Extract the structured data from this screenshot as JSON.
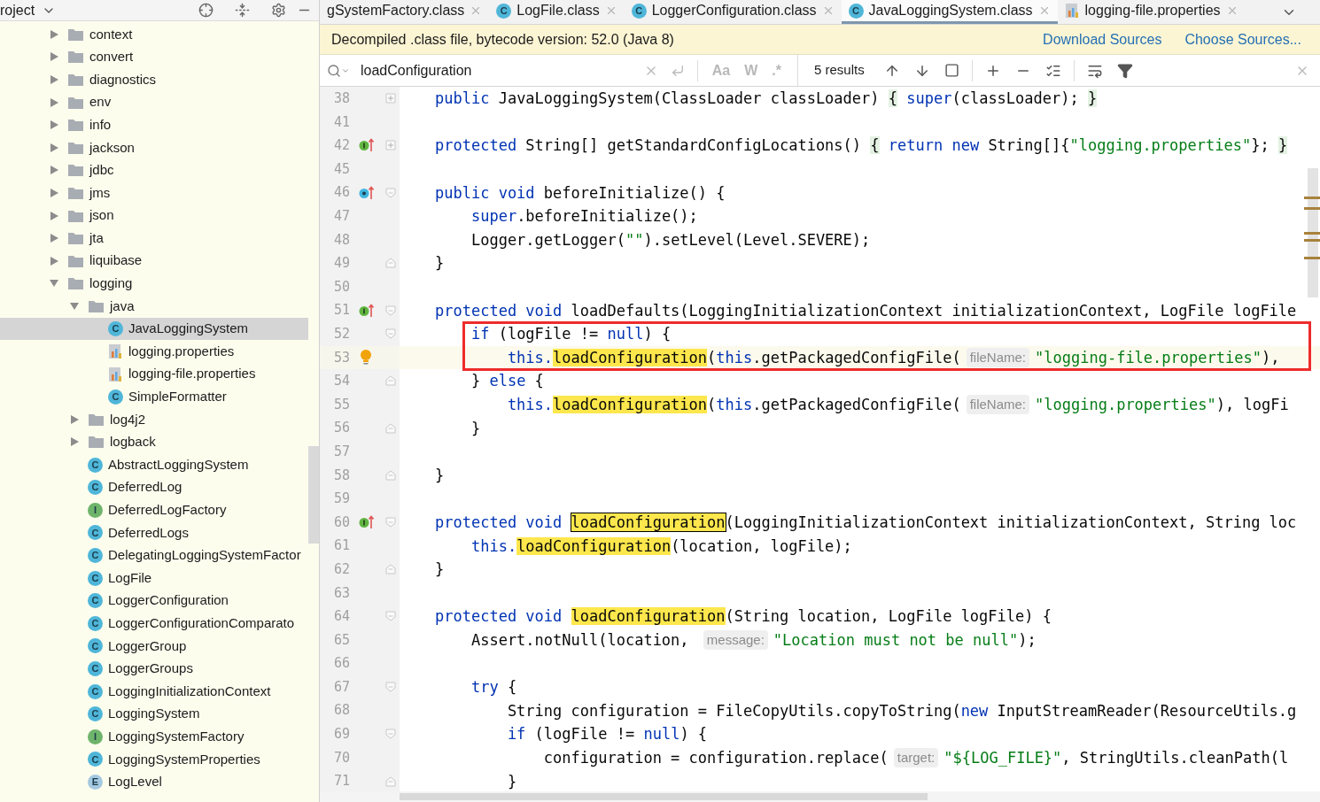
{
  "project_panel": {
    "title": "roject",
    "tree": [
      {
        "label": "context",
        "kind": "package",
        "expanded": false,
        "selected": false
      },
      {
        "label": "convert",
        "kind": "package",
        "expanded": false,
        "selected": false
      },
      {
        "label": "diagnostics",
        "kind": "package",
        "expanded": false,
        "selected": false
      },
      {
        "label": "env",
        "kind": "package",
        "expanded": false,
        "selected": false
      },
      {
        "label": "info",
        "kind": "package",
        "expanded": false,
        "selected": false
      },
      {
        "label": "jackson",
        "kind": "package",
        "expanded": false,
        "selected": false
      },
      {
        "label": "jdbc",
        "kind": "package",
        "expanded": false,
        "selected": false
      },
      {
        "label": "jms",
        "kind": "package",
        "expanded": false,
        "selected": false
      },
      {
        "label": "json",
        "kind": "package",
        "expanded": false,
        "selected": false
      },
      {
        "label": "jta",
        "kind": "package",
        "expanded": false,
        "selected": false
      },
      {
        "label": "liquibase",
        "kind": "package",
        "expanded": false,
        "selected": false
      },
      {
        "label": "logging",
        "kind": "package",
        "expanded": true,
        "selected": false,
        "children": [
          {
            "label": "java",
            "kind": "package",
            "expanded": true,
            "selected": false,
            "children": [
              {
                "label": "JavaLoggingSystem",
                "kind": "class",
                "badge": "C",
                "selected": true
              },
              {
                "label": "logging.properties",
                "kind": "properties",
                "selected": false
              },
              {
                "label": "logging-file.properties",
                "kind": "properties",
                "selected": false
              },
              {
                "label": "SimpleFormatter",
                "kind": "class",
                "badge": "C",
                "selected": false
              }
            ]
          },
          {
            "label": "log4j2",
            "kind": "package",
            "expanded": false,
            "selected": false
          },
          {
            "label": "logback",
            "kind": "package",
            "expanded": false,
            "selected": false
          },
          {
            "label": "AbstractLoggingSystem",
            "kind": "class",
            "badge": "C",
            "selected": false
          },
          {
            "label": "DeferredLog",
            "kind": "class",
            "badge": "C",
            "selected": false
          },
          {
            "label": "DeferredLogFactory",
            "kind": "interface",
            "badge": "I",
            "selected": false
          },
          {
            "label": "DeferredLogs",
            "kind": "class",
            "badge": "C",
            "selected": false
          },
          {
            "label": "DelegatingLoggingSystemFactor",
            "kind": "class",
            "badge": "C",
            "selected": false
          },
          {
            "label": "LogFile",
            "kind": "class",
            "badge": "C",
            "selected": false
          },
          {
            "label": "LoggerConfiguration",
            "kind": "class",
            "badge": "C",
            "selected": false
          },
          {
            "label": "LoggerConfigurationComparato",
            "kind": "class",
            "badge": "C",
            "selected": false
          },
          {
            "label": "LoggerGroup",
            "kind": "class",
            "badge": "C",
            "selected": false
          },
          {
            "label": "LoggerGroups",
            "kind": "class",
            "badge": "C",
            "selected": false
          },
          {
            "label": "LoggingInitializationContext",
            "kind": "class",
            "badge": "C",
            "selected": false
          },
          {
            "label": "LoggingSystem",
            "kind": "class",
            "badge": "C",
            "selected": false
          },
          {
            "label": "LoggingSystemFactory",
            "kind": "interface",
            "badge": "I",
            "selected": false
          },
          {
            "label": "LoggingSystemProperties",
            "kind": "class",
            "badge": "C",
            "selected": false
          },
          {
            "label": "LogLevel",
            "kind": "enum",
            "badge": "E",
            "selected": false
          }
        ]
      }
    ]
  },
  "tabs": [
    {
      "label": "gSystemFactory.class",
      "kind": "cut",
      "selected": false
    },
    {
      "label": "LogFile.class",
      "kind": "class",
      "badge": "C",
      "selected": false
    },
    {
      "label": "LoggerConfiguration.class",
      "kind": "class",
      "badge": "C",
      "selected": false
    },
    {
      "label": "JavaLoggingSystem.class",
      "kind": "class",
      "badge": "C",
      "selected": true
    },
    {
      "label": "logging-file.properties",
      "kind": "properties",
      "selected": false
    }
  ],
  "banner": {
    "text": "Decompiled .class file, bytecode version: 52.0 (Java 8)",
    "links": [
      "Download Sources",
      "Choose Sources..."
    ]
  },
  "search": {
    "query": "loadConfiguration",
    "options": [
      {
        "label": "Aa",
        "selected": false
      },
      {
        "label": "W",
        "selected": false
      },
      {
        "label": ".*",
        "selected": false
      }
    ],
    "results": "5 results"
  },
  "code": [
    {
      "n": "38",
      "fold": {
        "kind": "plus"
      },
      "current": false,
      "boxed": false,
      "t": [
        {
          "kind": "kw",
          "text": "public"
        },
        {
          "kind": "p",
          "text": " JavaLoggingSystem(ClassLoader classLoader) "
        },
        {
          "kind": "br",
          "text": "{"
        },
        {
          "kind": "kw",
          "text": " super"
        },
        {
          "kind": "p",
          "text": "(classLoader); "
        },
        {
          "kind": "br",
          "text": "}"
        }
      ]
    },
    {
      "n": "41",
      "current": false,
      "boxed": false
    },
    {
      "n": "42",
      "marker": {
        "kind": "implements"
      },
      "fold": {
        "kind": "plus"
      },
      "current": false,
      "boxed": false,
      "t": [
        {
          "kind": "kw",
          "text": "protected"
        },
        {
          "kind": "p",
          "text": " String[] getStandardConfigLocations() "
        },
        {
          "kind": "br",
          "text": "{"
        },
        {
          "kind": "kw",
          "text": " return new"
        },
        {
          "kind": "p",
          "text": " String[]{"
        },
        {
          "kind": "s",
          "text": "\"logging.properties\""
        },
        {
          "kind": "p",
          "text": "}; "
        },
        {
          "kind": "br",
          "text": "}"
        }
      ]
    },
    {
      "n": "45",
      "current": false,
      "boxed": false
    },
    {
      "n": "46",
      "marker": {
        "kind": "overrides"
      },
      "fold": {
        "kind": "open"
      },
      "current": false,
      "boxed": false,
      "t": [
        {
          "kind": "kw",
          "text": "public void"
        },
        {
          "kind": "p",
          "text": " beforeInitialize() {"
        }
      ]
    },
    {
      "n": "47",
      "current": false,
      "boxed": false,
      "t": [
        {
          "kind": "kw",
          "text": "    super"
        },
        {
          "kind": "p",
          "text": ".beforeInitialize();"
        }
      ]
    },
    {
      "n": "48",
      "current": false,
      "boxed": false,
      "t": [
        {
          "kind": "p",
          "text": "    Logger.getLogger("
        },
        {
          "kind": "s",
          "text": "\"\""
        },
        {
          "kind": "p",
          "text": ").setLevel(Level.SEVERE);"
        }
      ]
    },
    {
      "n": "49",
      "fold": {
        "kind": "close"
      },
      "current": false,
      "boxed": false,
      "t": [
        {
          "kind": "p",
          "text": "}"
        }
      ]
    },
    {
      "n": "50",
      "current": false,
      "boxed": false
    },
    {
      "n": "51",
      "marker": {
        "kind": "implements"
      },
      "fold": {
        "kind": "open"
      },
      "current": false,
      "boxed": false,
      "t": [
        {
          "kind": "kw",
          "text": "protected void"
        },
        {
          "kind": "p",
          "text": " loadDefaults(LoggingInitializationContext initializationContext, LogFile logFile"
        }
      ]
    },
    {
      "n": "52",
      "fold": {
        "kind": "open"
      },
      "current": false,
      "boxed": true,
      "t": [
        {
          "kind": "kw",
          "text": "    if"
        },
        {
          "kind": "p",
          "text": " (logFile != "
        },
        {
          "kind": "kw",
          "text": "null"
        },
        {
          "kind": "p",
          "text": ") {"
        }
      ]
    },
    {
      "n": "53",
      "marker": {
        "kind": "bulb"
      },
      "current": true,
      "boxed": true,
      "t": [
        {
          "kind": "kw",
          "text": "        this."
        },
        {
          "kind": "m",
          "text": "loadConfiguration"
        },
        {
          "kind": "p",
          "text": "("
        },
        {
          "kind": "kw",
          "text": "this"
        },
        {
          "kind": "p",
          "text": ".getPackagedConfigFile("
        },
        {
          "kind": "h",
          "text": "fileName:"
        },
        {
          "kind": "s",
          "text": "\"logging-file.properties\""
        },
        {
          "kind": "p",
          "text": "),"
        }
      ]
    },
    {
      "n": "54",
      "fold": {
        "kind": "close"
      },
      "current": false,
      "boxed": false,
      "t": [
        {
          "kind": "p",
          "text": "    } "
        },
        {
          "kind": "kw",
          "text": "else"
        },
        {
          "kind": "p",
          "text": " {"
        }
      ]
    },
    {
      "n": "55",
      "current": false,
      "boxed": false,
      "t": [
        {
          "kind": "kw",
          "text": "        this."
        },
        {
          "kind": "m",
          "text": "loadConfiguration"
        },
        {
          "kind": "p",
          "text": "("
        },
        {
          "kind": "kw",
          "text": "this"
        },
        {
          "kind": "p",
          "text": ".getPackagedConfigFile("
        },
        {
          "kind": "h",
          "text": "fileName:"
        },
        {
          "kind": "s",
          "text": "\"logging.properties\""
        },
        {
          "kind": "p",
          "text": "), logFi"
        }
      ]
    },
    {
      "n": "56",
      "fold": {
        "kind": "close"
      },
      "current": false,
      "boxed": false,
      "t": [
        {
          "kind": "p",
          "text": "    }"
        }
      ]
    },
    {
      "n": "57",
      "current": false,
      "boxed": false
    },
    {
      "n": "58",
      "fold": {
        "kind": "close"
      },
      "current": false,
      "boxed": false,
      "t": [
        {
          "kind": "p",
          "text": "}"
        }
      ]
    },
    {
      "n": "59",
      "current": false,
      "boxed": false
    },
    {
      "n": "60",
      "marker": {
        "kind": "implements"
      },
      "fold": {
        "kind": "open"
      },
      "current": false,
      "boxed": false,
      "t": [
        {
          "kind": "kw",
          "text": "protected void "
        },
        {
          "kind": "mc",
          "text": "loadConfiguration"
        },
        {
          "kind": "p",
          "text": "(LoggingInitializationContext initializationContext, String loc"
        }
      ]
    },
    {
      "n": "61",
      "current": false,
      "boxed": false,
      "t": [
        {
          "kind": "kw",
          "text": "    this."
        },
        {
          "kind": "m",
          "text": "loadConfiguration"
        },
        {
          "kind": "p",
          "text": "(location, logFile);"
        }
      ]
    },
    {
      "n": "62",
      "fold": {
        "kind": "close"
      },
      "current": false,
      "boxed": false,
      "t": [
        {
          "kind": "p",
          "text": "}"
        }
      ]
    },
    {
      "n": "63",
      "current": false,
      "boxed": false
    },
    {
      "n": "64",
      "fold": {
        "kind": "open"
      },
      "current": false,
      "boxed": false,
      "t": [
        {
          "kind": "kw",
          "text": "protected void "
        },
        {
          "kind": "m",
          "text": "loadConfiguration"
        },
        {
          "kind": "p",
          "text": "(String location, LogFile logFile) {"
        }
      ]
    },
    {
      "n": "65",
      "current": false,
      "boxed": false,
      "t": [
        {
          "kind": "p",
          "text": "    Assert.notNull(location, "
        },
        {
          "kind": "h",
          "text": "message:"
        },
        {
          "kind": "s",
          "text": "\"Location must not be null\""
        },
        {
          "kind": "p",
          "text": ");"
        }
      ]
    },
    {
      "n": "66",
      "current": false,
      "boxed": false
    },
    {
      "n": "67",
      "fold": {
        "kind": "open"
      },
      "current": false,
      "boxed": false,
      "t": [
        {
          "kind": "kw",
          "text": "    try"
        },
        {
          "kind": "p",
          "text": " {"
        }
      ]
    },
    {
      "n": "68",
      "current": false,
      "boxed": false,
      "t": [
        {
          "kind": "p",
          "text": "        String configuration = FileCopyUtils.copyToString("
        },
        {
          "kind": "kw",
          "text": "new"
        },
        {
          "kind": "p",
          "text": " InputStreamReader(ResourceUtils.g"
        }
      ]
    },
    {
      "n": "69",
      "fold": {
        "kind": "open"
      },
      "current": false,
      "boxed": false,
      "t": [
        {
          "kind": "kw",
          "text": "        if"
        },
        {
          "kind": "p",
          "text": " (logFile != "
        },
        {
          "kind": "kw",
          "text": "null"
        },
        {
          "kind": "p",
          "text": ") {"
        }
      ]
    },
    {
      "n": "70",
      "current": false,
      "boxed": false,
      "t": [
        {
          "kind": "p",
          "text": "            configuration = configuration.replace("
        },
        {
          "kind": "h",
          "text": "target:"
        },
        {
          "kind": "s",
          "text": "\"${LOG_FILE}\""
        },
        {
          "kind": "p",
          "text": ", StringUtils.cleanPath(l"
        }
      ]
    },
    {
      "n": "71",
      "fold": {
        "kind": "close"
      },
      "current": false,
      "boxed": false,
      "t": [
        {
          "kind": "p",
          "text": "        }"
        }
      ]
    }
  ]
}
